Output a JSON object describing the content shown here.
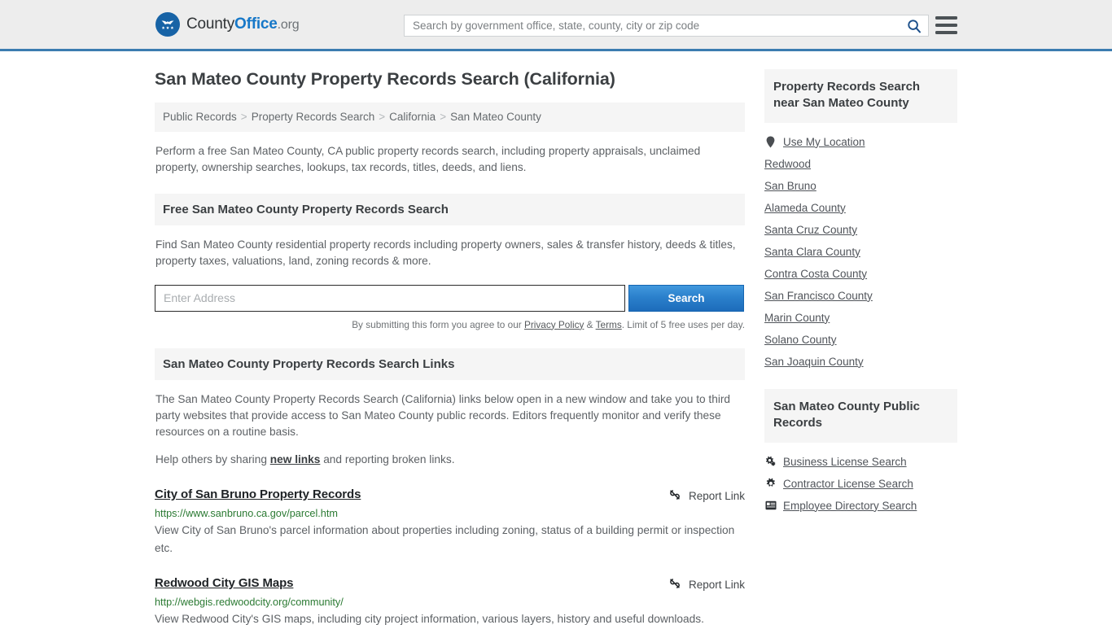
{
  "header": {
    "brand": {
      "part1": "County",
      "part2": "Office",
      "part3": ".org"
    },
    "search": {
      "placeholder": "Search by government office, state, county, city or zip code",
      "value": "",
      "icon": "search-icon"
    },
    "menu_icon": "hamburger-menu-icon"
  },
  "main": {
    "title": "San Mateo County Property Records Search (California)",
    "breadcrumb": [
      "Public Records",
      "Property Records Search",
      "California",
      "San Mateo County"
    ],
    "breadcrumb_separator": ">",
    "intro": "Perform a free San Mateo County, CA public property records search, including property appraisals, unclaimed property, ownership searches, lookups, tax records, titles, deeds, and liens.",
    "free_search": {
      "heading": "Free San Mateo County Property Records Search",
      "description": "Find San Mateo County residential property records including property owners, sales & transfer history, deeds & titles, property taxes, valuations, land, zoning records & more.",
      "address_placeholder": "Enter Address",
      "address_value": "",
      "search_button": "Search",
      "disclaimer_prefix": "By submitting this form you agree to our ",
      "privacy_policy": "Privacy Policy",
      "disclaimer_amp": " & ",
      "terms": "Terms",
      "disclaimer_suffix": ". Limit of 5 free uses per day."
    },
    "links_section": {
      "heading": "San Mateo County Property Records Search Links",
      "description": "The San Mateo County Property Records Search (California) links below open in a new window and take you to third party websites that provide access to San Mateo County public records. Editors frequently monitor and verify these resources on a routine basis.",
      "help_prefix": "Help others by sharing ",
      "help_link": "new links",
      "help_suffix": " and reporting broken links.",
      "report_label": "Report Link",
      "report_icon": "broken-link-icon",
      "results": [
        {
          "title": "City of San Bruno Property Records",
          "url": "https://www.sanbruno.ca.gov/parcel.htm",
          "description": "View City of San Bruno's parcel information about properties including zoning, status of a building permit or inspection etc."
        },
        {
          "title": "Redwood City GIS Maps",
          "url": "http://webgis.redwoodcity.org/community/",
          "description": "View Redwood City's GIS maps, including city project information, various layers, history and useful downloads."
        }
      ]
    }
  },
  "sidebar": {
    "nearby": {
      "heading": "Property Records Search near San Mateo County",
      "items": [
        {
          "label": "Use My Location",
          "icon": "map-pin-icon"
        },
        {
          "label": "Redwood",
          "icon": ""
        },
        {
          "label": "San Bruno",
          "icon": ""
        },
        {
          "label": "Alameda County",
          "icon": ""
        },
        {
          "label": "Santa Cruz County",
          "icon": ""
        },
        {
          "label": "Santa Clara County",
          "icon": ""
        },
        {
          "label": "Contra Costa County",
          "icon": ""
        },
        {
          "label": "San Francisco County",
          "icon": ""
        },
        {
          "label": "Marin County",
          "icon": ""
        },
        {
          "label": "Solano County",
          "icon": ""
        },
        {
          "label": "San Joaquin County",
          "icon": ""
        }
      ]
    },
    "public_records": {
      "heading": "San Mateo County Public Records",
      "items": [
        {
          "label": "Business License Search",
          "icon": "cogs-icon"
        },
        {
          "label": "Contractor License Search",
          "icon": "gear-icon"
        },
        {
          "label": "Employee Directory Search",
          "icon": "id-card-icon"
        }
      ]
    }
  },
  "colors": {
    "brand_blue": "#1778c8",
    "header_border": "#3b7cb0",
    "button_blue": "#2a7fcb",
    "url_green": "#2b7a33",
    "panel_gray": "#f5f5f5"
  }
}
